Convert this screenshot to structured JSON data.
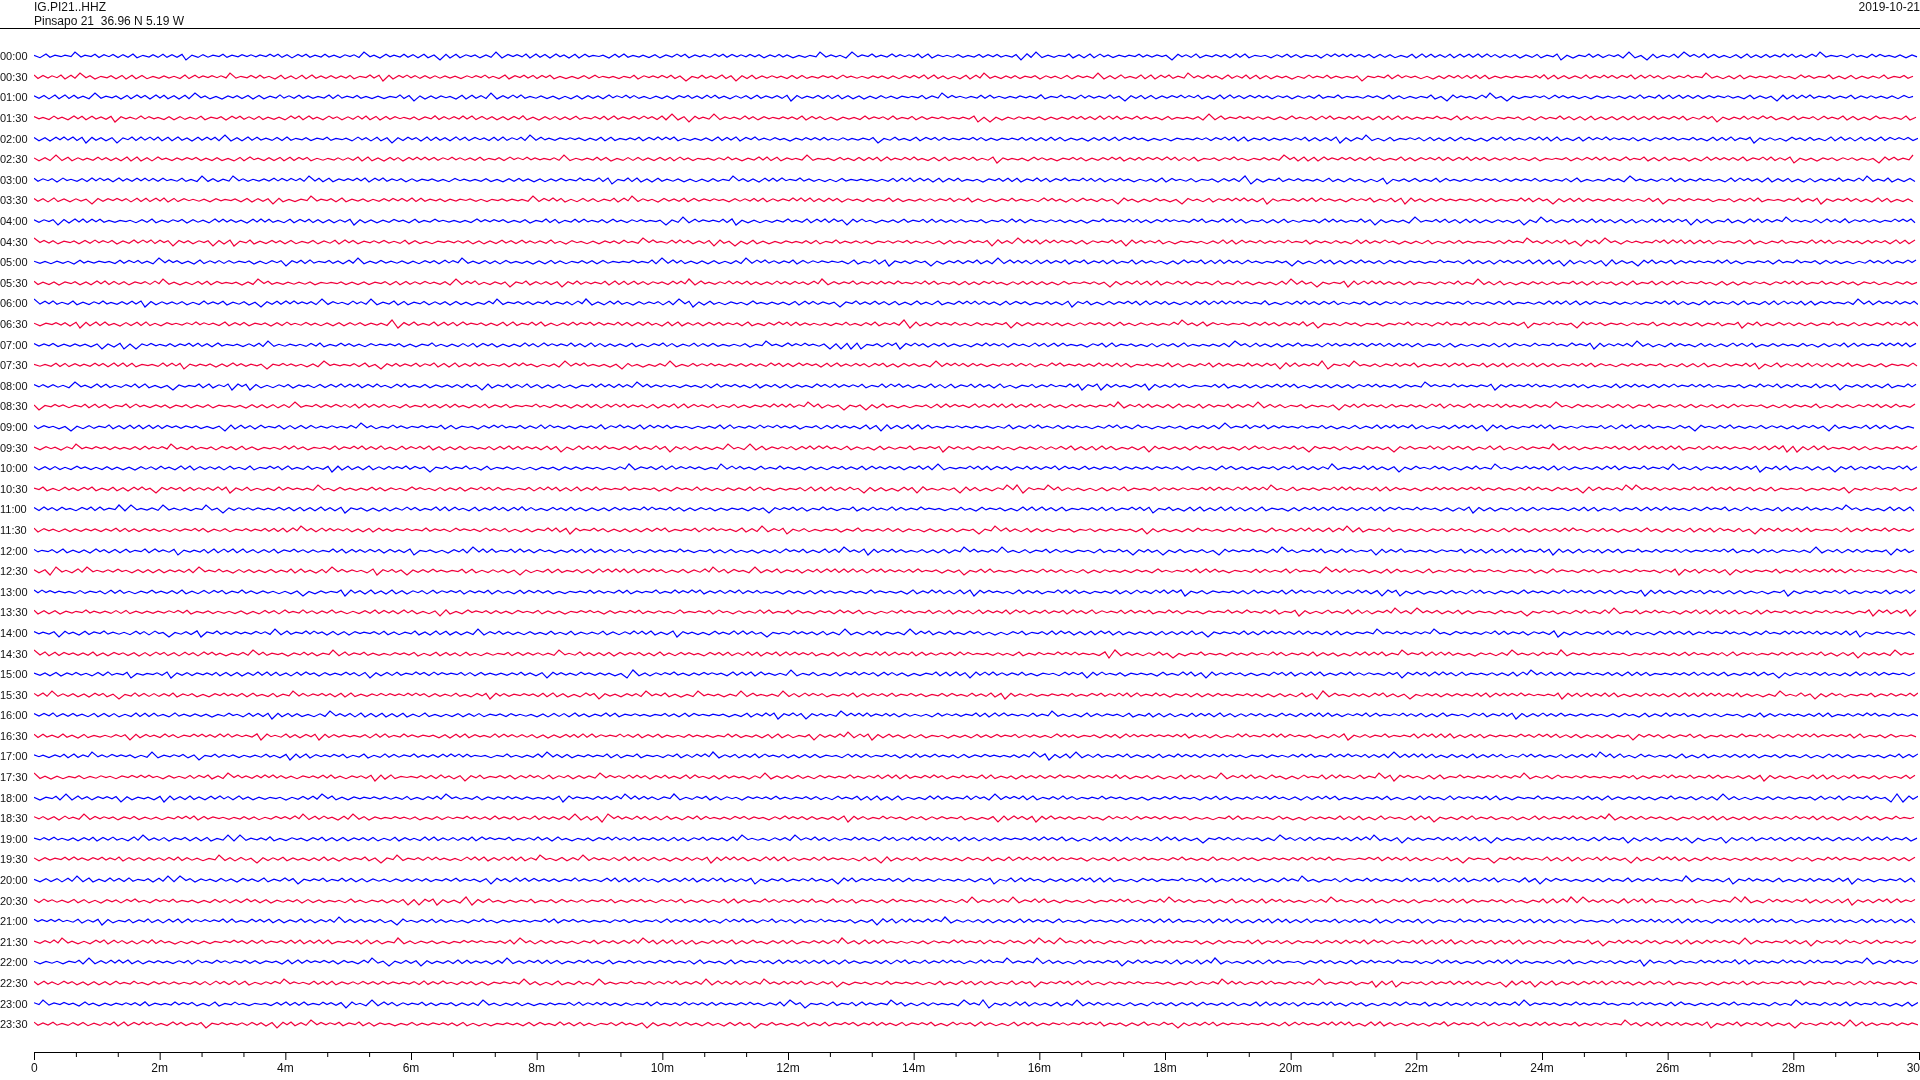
{
  "header": {
    "station_code": "IG.PI21..HHZ",
    "station_info": "Pinsapo 21  36.96 N 5.19 W",
    "date": "2019-10-21"
  },
  "traces": [
    {
      "label": "00:00",
      "color": "#0000ff"
    },
    {
      "label": "00:30",
      "color": "#f0003c"
    },
    {
      "label": "01:00",
      "color": "#0000ff"
    },
    {
      "label": "01:30",
      "color": "#f0003c"
    },
    {
      "label": "02:00",
      "color": "#0000ff"
    },
    {
      "label": "02:30",
      "color": "#f0003c"
    },
    {
      "label": "03:00",
      "color": "#0000ff"
    },
    {
      "label": "03:30",
      "color": "#f0003c"
    },
    {
      "label": "04:00",
      "color": "#0000ff"
    },
    {
      "label": "04:30",
      "color": "#f0003c"
    },
    {
      "label": "05:00",
      "color": "#0000ff"
    },
    {
      "label": "05:30",
      "color": "#f0003c"
    },
    {
      "label": "06:00",
      "color": "#0000ff"
    },
    {
      "label": "06:30",
      "color": "#f0003c"
    },
    {
      "label": "07:00",
      "color": "#0000ff"
    },
    {
      "label": "07:30",
      "color": "#f0003c"
    },
    {
      "label": "08:00",
      "color": "#0000ff"
    },
    {
      "label": "08:30",
      "color": "#f0003c"
    },
    {
      "label": "09:00",
      "color": "#0000ff"
    },
    {
      "label": "09:30",
      "color": "#f0003c"
    },
    {
      "label": "10:00",
      "color": "#0000ff"
    },
    {
      "label": "10:30",
      "color": "#f0003c"
    },
    {
      "label": "11:00",
      "color": "#0000ff"
    },
    {
      "label": "11:30",
      "color": "#f0003c"
    },
    {
      "label": "12:00",
      "color": "#0000ff"
    },
    {
      "label": "12:30",
      "color": "#f0003c"
    },
    {
      "label": "13:00",
      "color": "#0000ff"
    },
    {
      "label": "13:30",
      "color": "#f0003c"
    },
    {
      "label": "14:00",
      "color": "#0000ff"
    },
    {
      "label": "14:30",
      "color": "#f0003c"
    },
    {
      "label": "15:00",
      "color": "#0000ff"
    },
    {
      "label": "15:30",
      "color": "#f0003c"
    },
    {
      "label": "16:00",
      "color": "#0000ff"
    },
    {
      "label": "16:30",
      "color": "#f0003c"
    },
    {
      "label": "17:00",
      "color": "#0000ff"
    },
    {
      "label": "17:30",
      "color": "#f0003c"
    },
    {
      "label": "18:00",
      "color": "#0000ff"
    },
    {
      "label": "18:30",
      "color": "#f0003c"
    },
    {
      "label": "19:00",
      "color": "#0000ff"
    },
    {
      "label": "19:30",
      "color": "#f0003c"
    },
    {
      "label": "20:00",
      "color": "#0000ff"
    },
    {
      "label": "20:30",
      "color": "#f0003c"
    },
    {
      "label": "21:00",
      "color": "#0000ff"
    },
    {
      "label": "21:30",
      "color": "#f0003c"
    },
    {
      "label": "22:00",
      "color": "#0000ff"
    },
    {
      "label": "22:30",
      "color": "#f0003c"
    },
    {
      "label": "23:00",
      "color": "#0000ff"
    },
    {
      "label": "23:30",
      "color": "#f0003c"
    }
  ],
  "x_axis": {
    "tick_labels": [
      "0",
      "2m",
      "4m",
      "6m",
      "8m",
      "10m",
      "12m",
      "14m",
      "16m",
      "18m",
      "20m",
      "22m",
      "24m",
      "26m",
      "28m",
      "30"
    ]
  }
}
